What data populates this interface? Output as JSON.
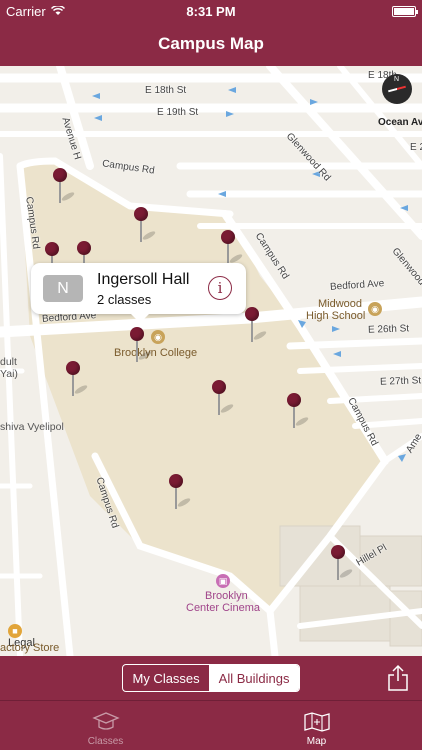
{
  "status": {
    "carrier": "Carrier",
    "time": "8:31 PM"
  },
  "nav": {
    "title": "Campus Map"
  },
  "map": {
    "streets": {
      "e18": "E 18th St",
      "e18b": "E 18th",
      "e19": "E 19th St",
      "avenue_h": "Avenue H",
      "campus_rd_top": "Campus Rd",
      "campus_rd_left": "Campus Rd",
      "campus_rd_right": "Campus Rd",
      "campus_rd_center": "Campus Rd",
      "campus_rd_bottom": "Campus Rd",
      "glenwood": "Glenwood Rd",
      "glenwood2": "Glenwood",
      "bedford_left": "Bedford Ave",
      "bedford_right": "Bedford Ave",
      "e26": "E 26th St",
      "e27": "E 27th St",
      "hillel": "Hillel Pl",
      "amersfort": "Ame",
      "e2_top": "E 2"
    },
    "ocean": "Ocean Av",
    "pois": {
      "brooklyn_college": "Brooklyn College",
      "midwood_hs_1": "Midwood",
      "midwood_hs_2": "High School",
      "cinema_1": "Brooklyn",
      "cinema_2": "Center Cinema",
      "legal": "Legal",
      "factory_store": "actory Store",
      "yeshiva": "shiva Vyelipol",
      "adult_1": "dult",
      "adult_2": "Yai)"
    },
    "callout": {
      "badge": "N",
      "title": "Ingersoll Hall",
      "subtitle": "2 classes",
      "info_icon": "i"
    },
    "compass_label": "N"
  },
  "toolbar": {
    "segments": [
      "My Classes",
      "All Buildings"
    ],
    "selected": "All Buildings"
  },
  "tabs": [
    {
      "label": "Classes",
      "icon": "graduation-cap-icon",
      "active": false
    },
    {
      "label": "Map",
      "icon": "map-icon",
      "active": true
    }
  ],
  "colors": {
    "brand": "#8b2a45",
    "pin": "#7a1b33",
    "campus": "#ece3cc"
  }
}
